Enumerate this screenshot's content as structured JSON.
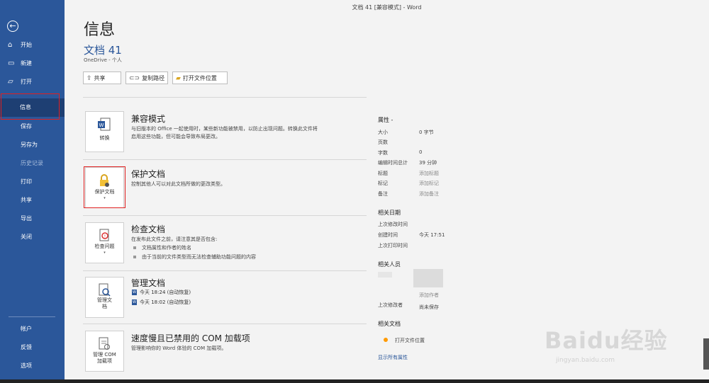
{
  "window": {
    "title": "文档 41 [兼容模式]  -  Word"
  },
  "nav": {
    "back_icon": "back-arrow-icon",
    "items": [
      {
        "label": "开始",
        "icon": "home-icon"
      },
      {
        "label": "新建",
        "icon": "new-doc-icon"
      },
      {
        "label": "打开",
        "icon": "open-folder-icon"
      },
      {
        "label": "信息",
        "selected": true
      },
      {
        "label": "保存"
      },
      {
        "label": "另存为"
      },
      {
        "label": "历史记录",
        "disabled": true
      },
      {
        "label": "打印"
      },
      {
        "label": "共享"
      },
      {
        "label": "导出"
      },
      {
        "label": "关闭"
      }
    ],
    "bottom_items": [
      {
        "label": "帐户"
      },
      {
        "label": "反馈"
      },
      {
        "label": "选项"
      }
    ]
  },
  "page": {
    "title": "信息",
    "doc_name": "文档 41",
    "doc_location": "OneDrive - 个人",
    "toolbar": [
      {
        "label": "共享",
        "icon": "share-icon"
      },
      {
        "label": "复制路径",
        "icon": "link-icon"
      },
      {
        "label": "打开文件位置",
        "icon": "folder-icon"
      }
    ]
  },
  "sections": {
    "compat": {
      "tile_label": "转换",
      "heading": "兼容模式",
      "desc1": "与旧版本的 Office 一起使用时，某些新功能被禁用，以防止出现问题。转换此文件将",
      "desc2": "启用这些功能，但可能会导致布局更改。"
    },
    "protect": {
      "tile_label": "保护文档",
      "heading": "保护文档",
      "desc": "控制其他人可以对此文档所做的更改类型。"
    },
    "inspect": {
      "tile_label": "检查问题",
      "heading": "检查文档",
      "desc": "在发布此文件之前，请注意其是否包含:",
      "bullets": [
        "文档属性和作者的姓名",
        "由于当前的文件类型而无法检查辅助功能问题的内容"
      ]
    },
    "manage": {
      "tile_label1": "管理文",
      "tile_label2": "档",
      "heading": "管理文档",
      "versions": [
        "今天 18:24 (自动恢复)",
        "今天 18:02 (自动恢复)"
      ]
    },
    "com": {
      "tile_label1": "管理 COM",
      "tile_label2": "加载项",
      "heading": "速度慢且已禁用的 COM 加载项",
      "desc": "管理影响你的 Word 体验的 COM 加载项。"
    }
  },
  "properties": {
    "heading": "属性 -",
    "rows": [
      {
        "key": "大小",
        "value": "0 字节"
      },
      {
        "key": "页数",
        "value": ""
      },
      {
        "key": "字数",
        "value": "0"
      },
      {
        "key": "编辑时间总计",
        "value": "39 分钟"
      },
      {
        "key": "标题",
        "value": "添加标题",
        "placeholder": true
      },
      {
        "key": "标记",
        "value": "添加标记",
        "placeholder": true
      },
      {
        "key": "备注",
        "value": "添加备注",
        "placeholder": true
      }
    ],
    "dates_heading": "相关日期",
    "dates": [
      {
        "key": "上次修改时间",
        "value": ""
      },
      {
        "key": "创建时间",
        "value": "今天 17:51"
      },
      {
        "key": "上次打印时间",
        "value": ""
      }
    ],
    "people_heading": "相关人员",
    "add_author": "添加作者",
    "last_modified_by_key": "上次修改者",
    "last_modified_by_value": "尚未保存",
    "docs_heading": "相关文档",
    "open_location": "打开文件位置",
    "show_all": "显示所有属性"
  },
  "watermark": {
    "text": "Baidu经验",
    "sub": "jingyan.baidu.com"
  },
  "colors": {
    "nav_bg": "#2b579a",
    "accent": "#2b579a",
    "highlight_box": "#e02020"
  }
}
